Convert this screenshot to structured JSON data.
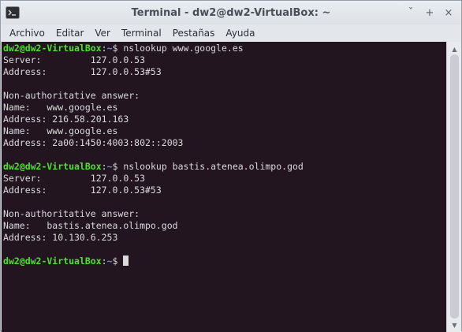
{
  "window": {
    "title": "Terminal - dw2@dw2-VirtualBox: ~",
    "controls": {
      "minimize": "ˇ",
      "maximize": "+",
      "close": "×"
    }
  },
  "menu": {
    "items": [
      {
        "label": "Archivo"
      },
      {
        "label": "Editar"
      },
      {
        "label": "Ver"
      },
      {
        "label": "Terminal"
      },
      {
        "label": "Pestañas"
      },
      {
        "label": "Ayuda"
      }
    ]
  },
  "terminal": {
    "prompt_user": "dw2@dw2-VirtualBox",
    "prompt_sep": ":",
    "prompt_path": "~",
    "prompt_symbol": "$",
    "commands": [
      {
        "command": " nslookup www.google.es",
        "output": [
          "Server:         127.0.0.53",
          "Address:        127.0.0.53#53",
          "",
          "Non-authoritative answer:",
          "Name:   www.google.es",
          "Address: 216.58.201.163",
          "Name:   www.google.es",
          "Address: 2a00:1450:4003:802::2003",
          ""
        ]
      },
      {
        "command": " nslookup bastis.atenea.olimpo.god",
        "output": [
          "Server:         127.0.0.53",
          "Address:        127.0.0.53#53",
          "",
          "Non-authoritative answer:",
          "Name:   bastis.atenea.olimpo.god",
          "Address: 10.130.6.253",
          ""
        ]
      }
    ],
    "final_prompt_trailing": " "
  },
  "colors": {
    "prompt_user": "#4ee22b",
    "prompt_path": "#6e8cd8",
    "terminal_bg": "#23151f",
    "terminal_fg": "#dadada"
  }
}
